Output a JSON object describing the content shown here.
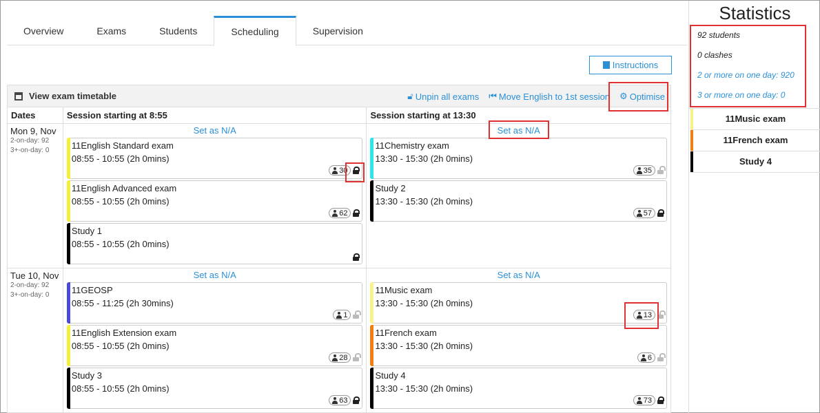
{
  "tabs": [
    {
      "label": "Overview"
    },
    {
      "label": "Exams"
    },
    {
      "label": "Students"
    },
    {
      "label": "Scheduling",
      "active": true
    },
    {
      "label": "Supervision"
    }
  ],
  "instructions_label": "Instructions",
  "panel": {
    "title": "View exam timetable",
    "actions": {
      "unpin": "Unpin all exams",
      "move_english": "Move English to 1st session",
      "optimise": "Optimise"
    },
    "columns": {
      "dates": "Dates",
      "session1": "Session starting at 8:55",
      "session2": "Session starting at 13:30"
    }
  },
  "set_na_label": "Set as N/A",
  "days": [
    {
      "name": "Mon 9, Nov",
      "two_on_day": "2-on-day: 92",
      "three_on_day": "3+-on-day: 0",
      "s1": [
        {
          "name": "11English Standard exam",
          "time": "08:55 - 10:55  (2h 0mins)",
          "count": "30",
          "locked": true,
          "color": "#f5ef3a"
        },
        {
          "name": "11English Advanced exam",
          "time": "08:55 - 10:55  (2h 0mins)",
          "count": "62",
          "locked": true,
          "color": "#f5ef3a"
        },
        {
          "name": "Study 1",
          "time": "08:55 - 10:55  (2h 0mins)",
          "count": "",
          "locked": true,
          "color": "#000000"
        }
      ],
      "s2": [
        {
          "name": "11Chemistry exam",
          "time": "13:30 - 15:30  (2h 0mins)",
          "count": "35",
          "locked": false,
          "color": "#2ee6e6"
        },
        {
          "name": "Study 2",
          "time": "13:30 - 15:30  (2h 0mins)",
          "count": "57",
          "locked": true,
          "color": "#000000"
        }
      ]
    },
    {
      "name": "Tue 10, Nov",
      "two_on_day": "2-on-day: 92",
      "three_on_day": "3+-on-day: 0",
      "s1": [
        {
          "name": "11GEOSP",
          "time": "08:55 - 11:25  (2h 30mins)",
          "count": "1",
          "locked": false,
          "color": "#4a4ad6"
        },
        {
          "name": "11English Extension exam",
          "time": "08:55 - 10:55  (2h 0mins)",
          "count": "28",
          "locked": false,
          "color": "#f5ef3a"
        },
        {
          "name": "Study 3",
          "time": "08:55 - 10:55  (2h 0mins)",
          "count": "63",
          "locked": true,
          "color": "#000000"
        }
      ],
      "s2": [
        {
          "name": "11Music exam",
          "time": "13:30 - 15:30  (2h 0mins)",
          "count": "13",
          "locked": false,
          "color": "#f7f38a"
        },
        {
          "name": "11French exam",
          "time": "13:30 - 15:30  (2h 0mins)",
          "count": "6",
          "locked": false,
          "color": "#f07f10"
        },
        {
          "name": "Study 4",
          "time": "13:30 - 15:30  (2h 0mins)",
          "count": "73",
          "locked": true,
          "color": "#000000"
        }
      ]
    }
  ],
  "stats": {
    "title": "Statistics",
    "students": "92 students",
    "clashes": "0 clashes",
    "two_or_more": "2 or more on one day: 920",
    "three_or_more": "3 or more on one day: 0"
  },
  "unscheduled": [
    {
      "name": "11Music exam",
      "color": "#f7f38a"
    },
    {
      "name": "11French exam",
      "color": "#f07f10"
    },
    {
      "name": "Study 4",
      "color": "#000000"
    }
  ],
  "accent_color": "#2a8fd6",
  "highlight_color": "#e03030"
}
